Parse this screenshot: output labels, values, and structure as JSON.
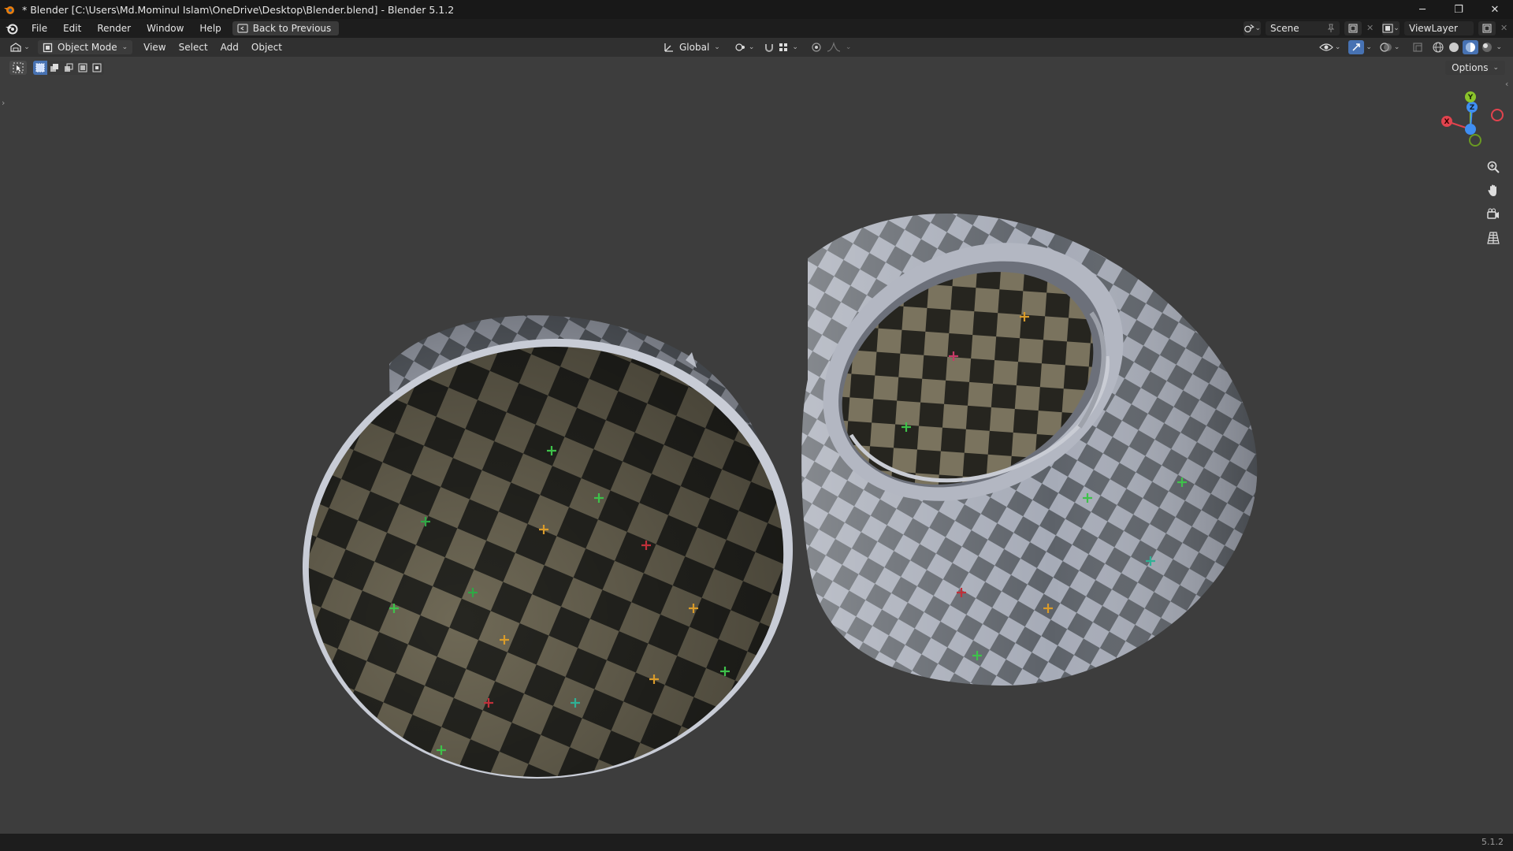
{
  "window": {
    "title": "* Blender [C:\\Users\\Md.Mominul Islam\\OneDrive\\Desktop\\Blender.blend] - Blender 5.1.2",
    "controls": [
      "─",
      "❐",
      "✕"
    ]
  },
  "topbar": {
    "menus": [
      "File",
      "Edit",
      "Render",
      "Window",
      "Help"
    ],
    "back_button": "Back to Previous",
    "scene_name": "Scene",
    "view_layer": "ViewLayer"
  },
  "viewport_header": {
    "mode": "Object Mode",
    "menus": [
      "View",
      "Select",
      "Add",
      "Object"
    ],
    "transform_orientation": "Global"
  },
  "toolbar": {
    "options_label": "Options"
  },
  "gizmo": {
    "axes": [
      "Y",
      "X",
      "Z"
    ],
    "colors": {
      "x": "#e2434e",
      "y": "#8bc42b",
      "z": "#3f8ef3"
    }
  },
  "statusbar": {
    "version": "5.1.2"
  },
  "icons": [
    "blender-logo-icon",
    "back-icon",
    "scene-icon",
    "pin-icon",
    "new-scene-icon",
    "view-layer-icon",
    "editor-type-icon",
    "object-mode-icon",
    "orientation-icon",
    "pivot-icon",
    "snap-icon",
    "proportional-edit-icon",
    "visibility-icon",
    "gizmo-icon",
    "overlay-icon",
    "xray-icon",
    "wireframe-shading-icon",
    "solid-shading-icon",
    "material-shading-icon",
    "rendered-shading-icon",
    "select-tool-icon",
    "zoom-icon",
    "pan-icon",
    "camera-icon",
    "grid-icon"
  ]
}
